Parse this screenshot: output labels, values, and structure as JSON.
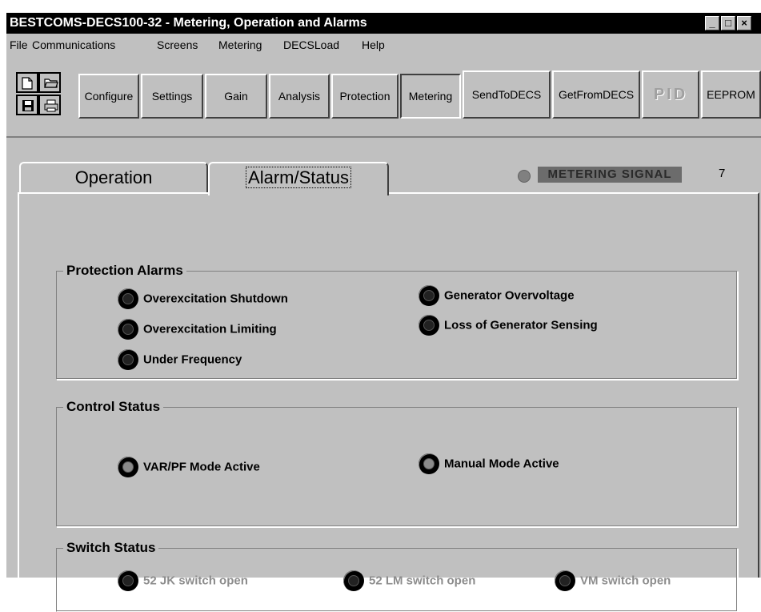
{
  "window": {
    "title": "BESTCOMS-DECS100-32 - Metering, Operation and Alarms",
    "minimize": "_",
    "maximize": "□",
    "close": "×"
  },
  "menu": [
    {
      "label": "File"
    },
    {
      "label": "Communications"
    },
    {
      "label": "Screens"
    },
    {
      "label": "Metering"
    },
    {
      "label": "DECSLoad"
    },
    {
      "label": "Help"
    }
  ],
  "toolbar": {
    "icons": [
      "new-file-icon",
      "open-folder-icon",
      "save-disk-icon",
      "printer-icon"
    ],
    "buttons": {
      "configure": "Configure",
      "settings": "Settings",
      "gain": "Gain",
      "analysis": "Analysis",
      "protection": "Protection",
      "metering": "Metering",
      "send": "SendToDECS",
      "get": "GetFromDECS",
      "pid": "PID",
      "eeprom": "EEPROM"
    }
  },
  "tabs": {
    "operation": "Operation",
    "alarm_status": "Alarm/Status",
    "active": "Alarm/Status"
  },
  "metering_signal": {
    "label": "METERING SIGNAL",
    "value": "7"
  },
  "protection_alarms": {
    "title": "Protection Alarms",
    "items": [
      "Overexcitation Shutdown",
      "Overexcitation Limiting",
      "Under Frequency",
      "Generator Overvoltage",
      "Loss of Generator Sensing"
    ]
  },
  "control_status": {
    "title": "Control Status",
    "items": [
      "VAR/PF Mode Active",
      "Manual Mode Active"
    ]
  },
  "switch_status": {
    "title": "Switch Status",
    "items": [
      "52 JK switch open",
      "52 LM switch open",
      "VM switch open"
    ]
  },
  "colors": {
    "titlebar": "#000000",
    "face": "#c0c0c0",
    "disabled_text": "#8c8c8c",
    "metering_signal_bg": "#6c6c6c"
  }
}
